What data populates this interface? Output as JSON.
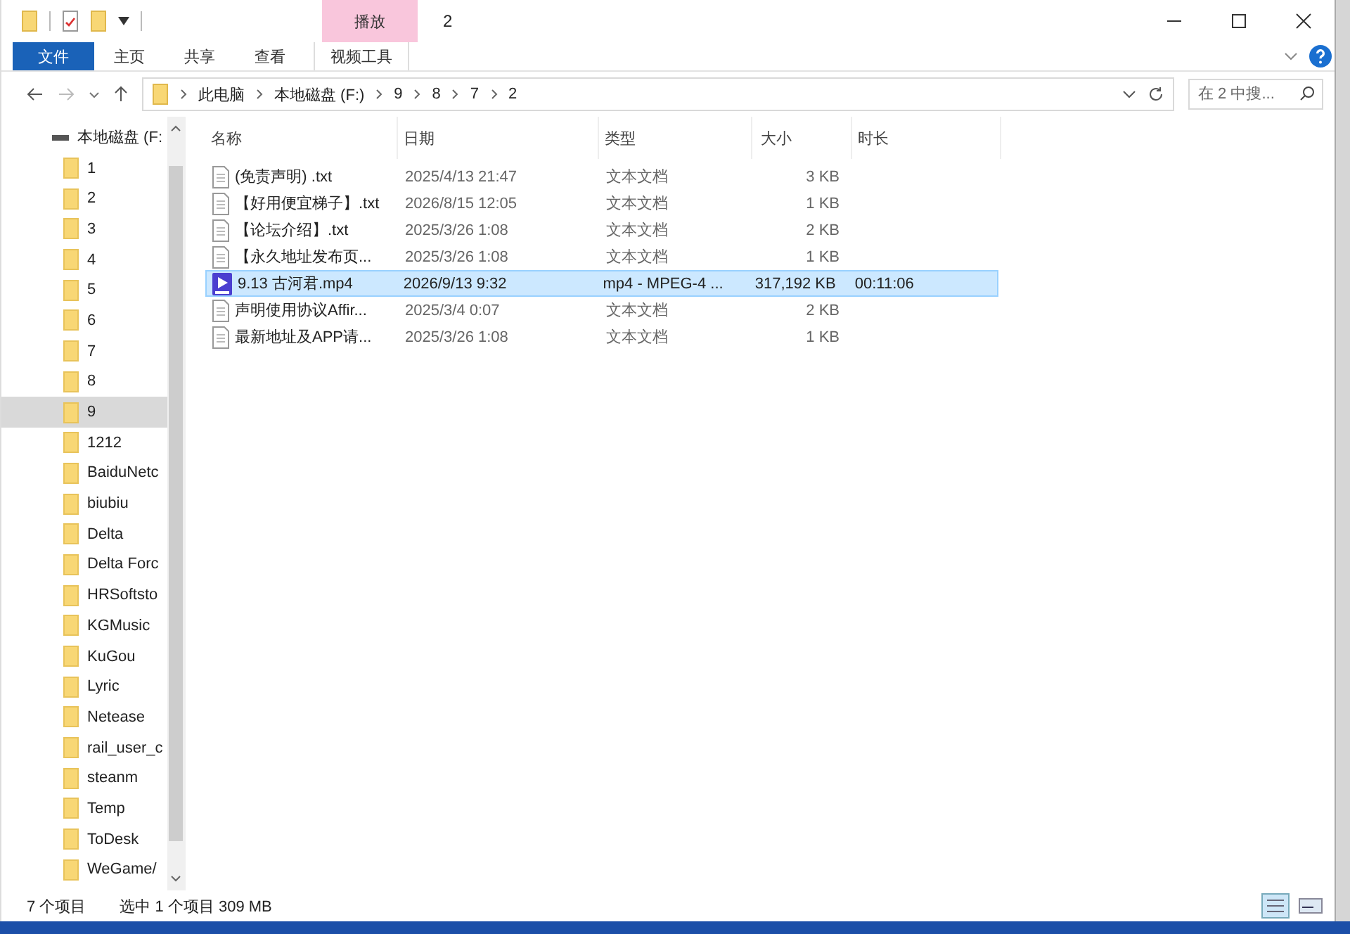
{
  "window": {
    "title": "2",
    "context_tab": "播放"
  },
  "ribbon_tabs": [
    {
      "label": "文件",
      "kind": "file",
      "selected": false
    },
    {
      "label": "主页",
      "kind": "tab",
      "selected": false
    },
    {
      "label": "共享",
      "kind": "tab",
      "selected": false
    },
    {
      "label": "查看",
      "kind": "tab",
      "selected": false
    },
    {
      "label": "视频工具",
      "kind": "context",
      "selected": false
    }
  ],
  "breadcrumb": [
    "此电脑",
    "本地磁盘 (F:)",
    "9",
    "8",
    "7",
    "2"
  ],
  "search": {
    "placeholder": "在 2 中搜..."
  },
  "sidebar": {
    "drive": "本地磁盘 (F:",
    "items": [
      {
        "label": "1",
        "selected": false
      },
      {
        "label": "2",
        "selected": false
      },
      {
        "label": "3",
        "selected": false
      },
      {
        "label": "4",
        "selected": false
      },
      {
        "label": "5",
        "selected": false
      },
      {
        "label": "6",
        "selected": false
      },
      {
        "label": "7",
        "selected": false
      },
      {
        "label": "8",
        "selected": false
      },
      {
        "label": "9",
        "selected": true
      },
      {
        "label": "1212",
        "selected": false
      },
      {
        "label": "BaiduNetc",
        "selected": false
      },
      {
        "label": "biubiu",
        "selected": false
      },
      {
        "label": "Delta",
        "selected": false
      },
      {
        "label": "Delta Forc",
        "selected": false
      },
      {
        "label": "HRSoftsto",
        "selected": false
      },
      {
        "label": "KGMusic",
        "selected": false
      },
      {
        "label": "KuGou",
        "selected": false
      },
      {
        "label": "Lyric",
        "selected": false
      },
      {
        "label": "Netease",
        "selected": false
      },
      {
        "label": "rail_user_c",
        "selected": false
      },
      {
        "label": "steanm",
        "selected": false
      },
      {
        "label": "Temp",
        "selected": false
      },
      {
        "label": "ToDesk",
        "selected": false
      },
      {
        "label": "WeGame/",
        "selected": false
      }
    ]
  },
  "table": {
    "columns": [
      "名称",
      "日期",
      "类型",
      "大小",
      "时长"
    ],
    "rows": [
      {
        "kind": "text",
        "name": "(免责声明) .txt",
        "date": "2025/4/13 21:47",
        "type": "文本文档",
        "size": "3 KB",
        "selected": false
      },
      {
        "kind": "text",
        "name": "【好用便宜梯子】.txt",
        "date": "2026/8/15 12:05",
        "type": "文本文档",
        "size": "1 KB",
        "selected": false
      },
      {
        "kind": "text",
        "name": "【论坛介绍】.txt",
        "date": "2025/3/26 1:08",
        "type": "文本文档",
        "size": "2 KB",
        "selected": false
      },
      {
        "kind": "text",
        "name": "【永久地址发布页...",
        "date": "2025/3/26 1:08",
        "type": "文本文档",
        "size": "1 KB",
        "selected": false
      },
      {
        "kind": "video",
        "name": "9.13 古河君.mp4",
        "date": "2026/9/13 9:32",
        "type": "mp4 - MPEG-4 ...",
        "size": "317,192 KB",
        "duration": "00:11:06",
        "selected": true
      },
      {
        "kind": "text",
        "name": "声明使用协议Affir...",
        "date": "2025/3/4 0:07",
        "type": "文本文档",
        "size": "2 KB",
        "selected": false
      },
      {
        "kind": "text",
        "name": "最新地址及APP请...",
        "date": "2025/3/26 1:08",
        "type": "文本文档",
        "size": "1 KB",
        "selected": false
      }
    ]
  },
  "status_bar": {
    "count": "7 个项目",
    "selection": "选中 1 个项目  309 MB"
  }
}
